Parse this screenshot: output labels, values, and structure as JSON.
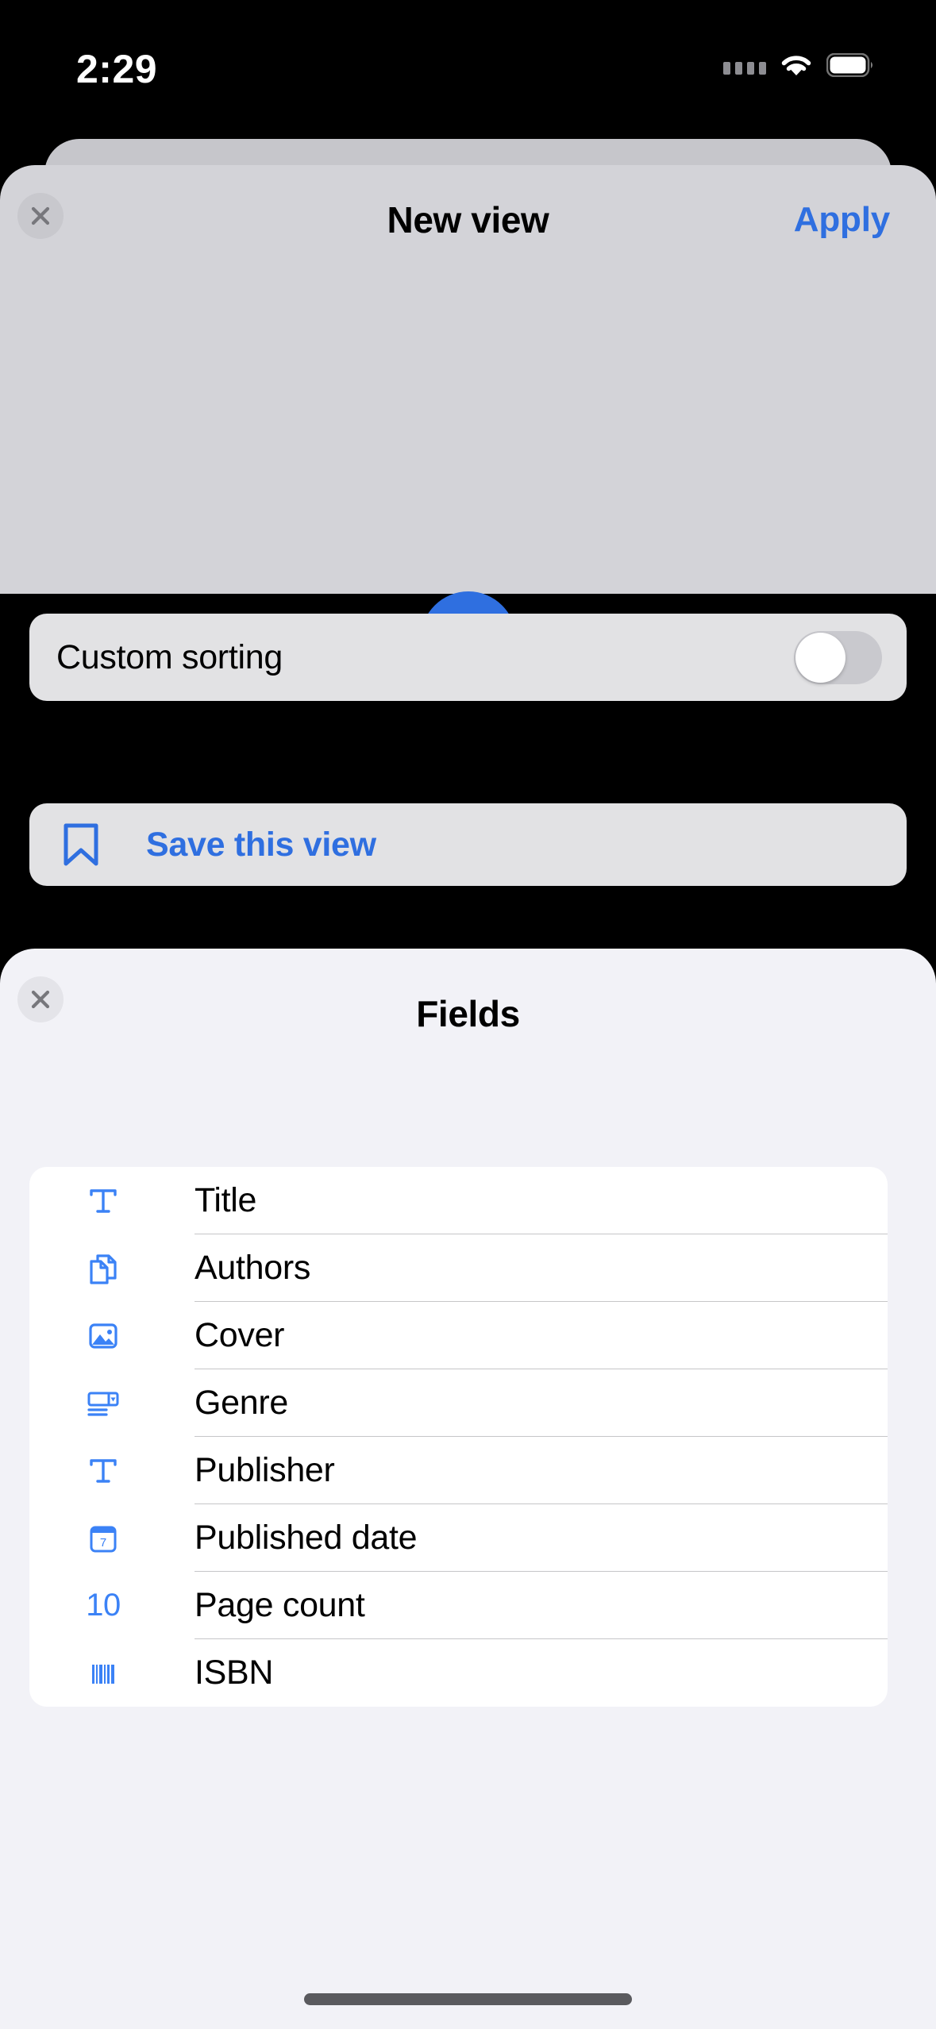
{
  "status_bar": {
    "time": "2:29",
    "icons": [
      "cellular-dots-icon",
      "wifi-icon",
      "battery-icon"
    ]
  },
  "view_sheet": {
    "title": "New view",
    "close_label": "×",
    "apply_label": "Apply",
    "add_button_label": "+",
    "custom_sorting": {
      "label": "Custom sorting",
      "toggle_state": "off"
    },
    "save_view": {
      "label": "Save this view",
      "icon": "bookmark-icon"
    }
  },
  "fields_sheet": {
    "title": "Fields",
    "close_label": "×",
    "items": [
      {
        "label": "Title",
        "icon": "text-icon"
      },
      {
        "label": "Authors",
        "icon": "documents-icon"
      },
      {
        "label": "Cover",
        "icon": "image-icon"
      },
      {
        "label": "Genre",
        "icon": "select-dropdown-icon"
      },
      {
        "label": "Publisher",
        "icon": "text-icon"
      },
      {
        "label": "Published date",
        "icon": "calendar-icon",
        "icon_text": "7"
      },
      {
        "label": "Page count",
        "icon": "number-icon",
        "icon_text": "10"
      },
      {
        "label": "ISBN",
        "icon": "barcode-icon"
      }
    ]
  },
  "colors": {
    "accent_blue": "#2f6fe0",
    "icon_blue": "#3b82f6",
    "sheet_gray": "#d3d3d8",
    "fields_bg": "#f2f2f7"
  }
}
